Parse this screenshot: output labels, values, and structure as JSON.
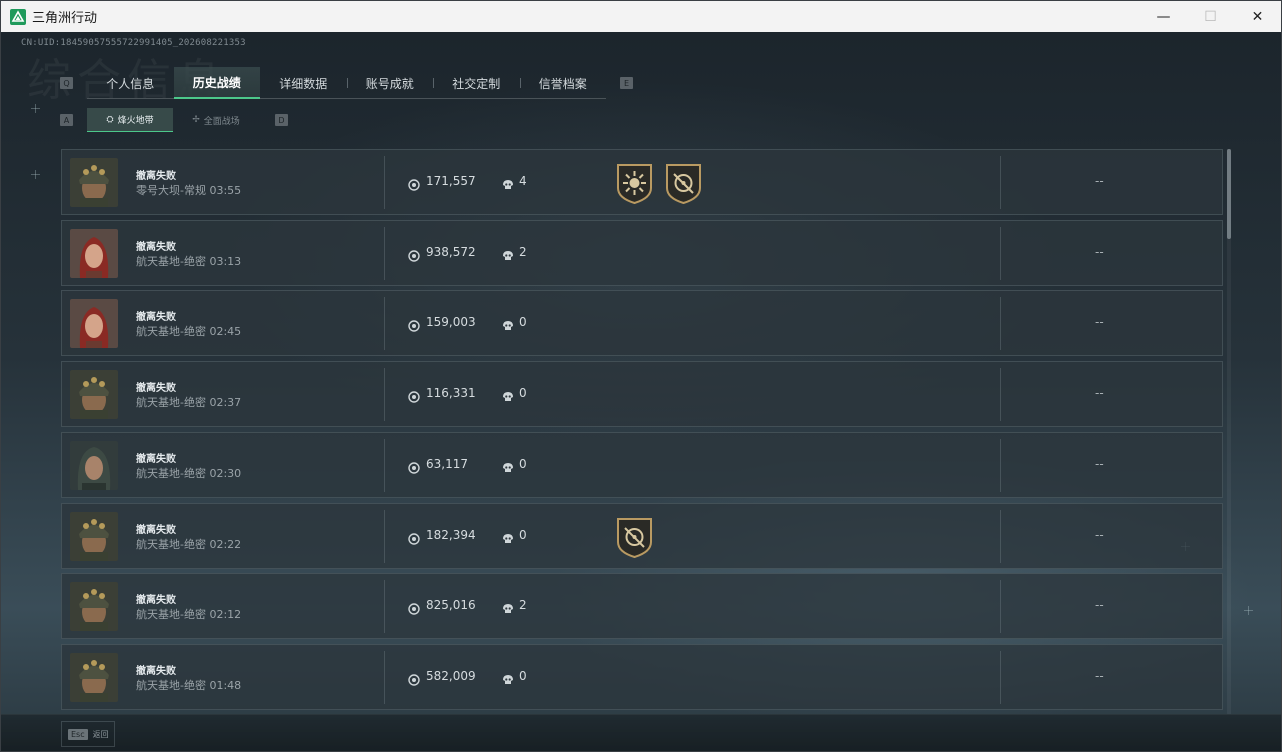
{
  "window": {
    "title": "三角洲行动",
    "controls": {
      "minimize": "—",
      "maximize": "☐",
      "close": "✕"
    }
  },
  "header": {
    "uid": "CN:UID:18459057555722991405_202608221353",
    "watermark": "综合信息",
    "key_left": "Q",
    "key_right": "E"
  },
  "tabs": [
    {
      "label": "个人信息"
    },
    {
      "label": "历史战绩",
      "active": true
    },
    {
      "label": "详细数据"
    },
    {
      "label": "账号成就"
    },
    {
      "label": "社交定制"
    },
    {
      "label": "信誉档案"
    }
  ],
  "subtabs": {
    "key_left": "A",
    "key_right": "D",
    "items": [
      {
        "label": "烽火地带",
        "icon": "campfire-icon",
        "active": true
      },
      {
        "label": "全面战场",
        "icon": "battlefield-icon"
      }
    ]
  },
  "matches": [
    {
      "result": "撤离失败",
      "map": "零号大坝-常规 03:55",
      "value": "171,557",
      "kills": "4",
      "badges": [
        "sun-badge-icon",
        "crosshair-badge-icon"
      ],
      "extra": "--",
      "portrait": "helmet-soldier"
    },
    {
      "result": "撤离失败",
      "map": "航天基地-绝密 03:13",
      "value": "938,572",
      "kills": "2",
      "badges": [],
      "extra": "--",
      "portrait": "red-hair"
    },
    {
      "result": "撤离失败",
      "map": "航天基地-绝密 02:45",
      "value": "159,003",
      "kills": "0",
      "badges": [],
      "extra": "--",
      "portrait": "red-hair"
    },
    {
      "result": "撤离失败",
      "map": "航天基地-绝密 02:37",
      "value": "116,331",
      "kills": "0",
      "badges": [],
      "extra": "--",
      "portrait": "helmet-soldier"
    },
    {
      "result": "撤离失败",
      "map": "航天基地-绝密 02:30",
      "value": "63,117",
      "kills": "0",
      "badges": [],
      "extra": "--",
      "portrait": "hooded"
    },
    {
      "result": "撤离失败",
      "map": "航天基地-绝密 02:22",
      "value": "182,394",
      "kills": "0",
      "badges": [
        "crosshair-badge-icon"
      ],
      "extra": "--",
      "portrait": "helmet-soldier"
    },
    {
      "result": "撤离失败",
      "map": "航天基地-绝密 02:12",
      "value": "825,016",
      "kills": "2",
      "badges": [],
      "extra": "--",
      "portrait": "helmet-soldier"
    },
    {
      "result": "撤离失败",
      "map": "航天基地-绝密 01:48",
      "value": "582,009",
      "kills": "0",
      "badges": [],
      "extra": "--",
      "portrait": "helmet-soldier"
    }
  ],
  "footer": {
    "esc_key": "Esc",
    "back_label": "返回"
  },
  "colors": {
    "accent": "#4cc88a",
    "row_bg": "#2c363c",
    "text": "#d6dcdf"
  }
}
